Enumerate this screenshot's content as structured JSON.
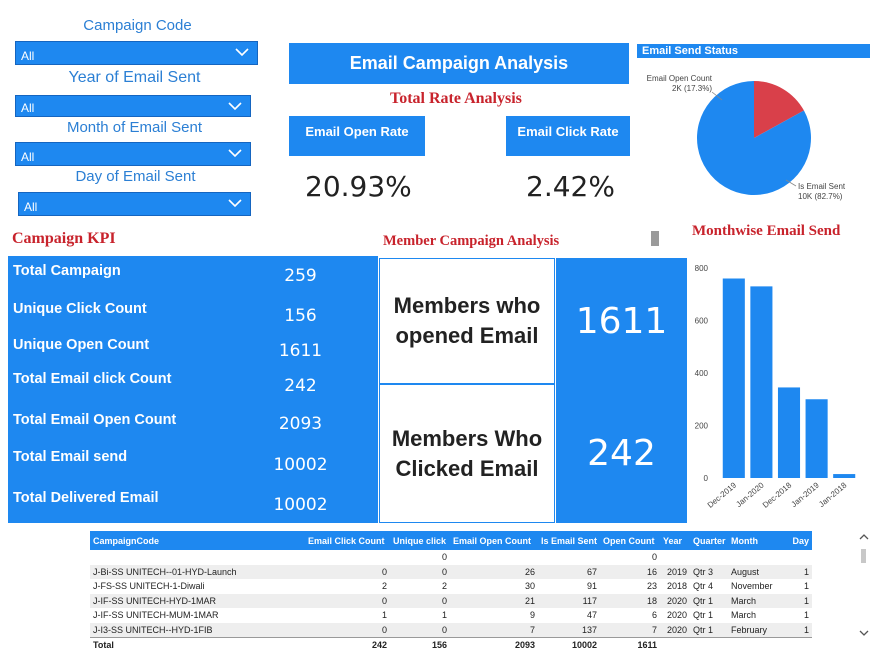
{
  "filters": [
    {
      "label": "Campaign Code",
      "value": "All"
    },
    {
      "label": "Year of Email Sent",
      "value": "All"
    },
    {
      "label": "Month of Email Sent",
      "value": "All"
    },
    {
      "label": "Day of Email Sent",
      "value": "All"
    }
  ],
  "header": {
    "title": "Email Campaign Analysis",
    "subtitle": "Total Rate Analysis"
  },
  "rates": {
    "open_label": "Email Open Rate",
    "open_value": "20.93%",
    "click_label": "Email Click Rate",
    "click_value": "2.42%"
  },
  "campaign_kpi": {
    "title": "Campaign KPI",
    "items": [
      {
        "label": "Total Campaign",
        "value": "259"
      },
      {
        "label": "Unique Click Count",
        "value": "156"
      },
      {
        "label": "Unique Open Count",
        "value": "1611"
      },
      {
        "label": "Total Email click Count",
        "value": "242"
      },
      {
        "label": "Total Email Open Count",
        "value": "2093"
      },
      {
        "label": "Total Email send",
        "value": "10002"
      },
      {
        "label": "Total Delivered Email",
        "value": "10002"
      }
    ]
  },
  "member_analysis": {
    "title": "Member Campaign Analysis",
    "opened_label": "Members who opened Email",
    "opened_value": "1611",
    "clicked_label": "Members Who Clicked Email",
    "clicked_value": "242"
  },
  "colors": {
    "primary": "#1e88f0",
    "title_red": "#c8232c",
    "pie_red": "#d9404a",
    "link_blue": "#2b7fd4"
  },
  "chart_data": [
    {
      "type": "pie",
      "title": "Email Send Status",
      "slices": [
        {
          "name": "Email Open Count",
          "value": 1.7,
          "label_value": "2K (17.3%)",
          "color": "#d9404a"
        },
        {
          "name": "Is Email Sent",
          "value": 8.3,
          "label_value": "10K (82.7%)",
          "color": "#1e88f0"
        }
      ],
      "percent": [
        17.3,
        82.7
      ]
    },
    {
      "type": "bar",
      "title": "Monthwise Email Send",
      "categories": [
        "Dec-2019",
        "Jan-2020",
        "Dec-2018",
        "Jan-2019",
        "Jan-2018"
      ],
      "values": [
        760,
        730,
        345,
        300,
        15
      ],
      "ylim": [
        0,
        800
      ],
      "yticks": [
        "0",
        "200",
        "400",
        "600",
        "800"
      ],
      "grid": false
    }
  ],
  "table": {
    "columns": [
      "CampaignCode",
      "Email Click Count",
      "Unique click",
      "Email Open Count",
      "Is Email Sent",
      "Open Count",
      "Year",
      "Quarter",
      "Month",
      "Day"
    ],
    "rows": [
      [
        "",
        "",
        "0",
        "",
        "",
        "0",
        "",
        "",
        "",
        ""
      ],
      [
        "J-Bi-SS UNITECH--01-HYD-Launch",
        "0",
        "0",
        "26",
        "67",
        "16",
        "2019",
        "Qtr 3",
        "August",
        "1"
      ],
      [
        "J-FS-SS UNITECH-1-Diwali",
        "2",
        "2",
        "30",
        "91",
        "23",
        "2018",
        "Qtr 4",
        "November",
        "1"
      ],
      [
        "J-IF-SS UNITECH-HYD-1MAR",
        "0",
        "0",
        "21",
        "117",
        "18",
        "2020",
        "Qtr 1",
        "March",
        "1"
      ],
      [
        "J-IF-SS UNITECH-MUM-1MAR",
        "1",
        "1",
        "9",
        "47",
        "6",
        "2020",
        "Qtr 1",
        "March",
        "1"
      ],
      [
        "J-I3-SS UNITECH--HYD-1FIB",
        "0",
        "0",
        "7",
        "137",
        "7",
        "2020",
        "Qtr 1",
        "February",
        "1"
      ]
    ],
    "total": [
      "Total",
      "242",
      "156",
      "2093",
      "10002",
      "1611",
      "",
      "",
      "",
      ""
    ]
  }
}
